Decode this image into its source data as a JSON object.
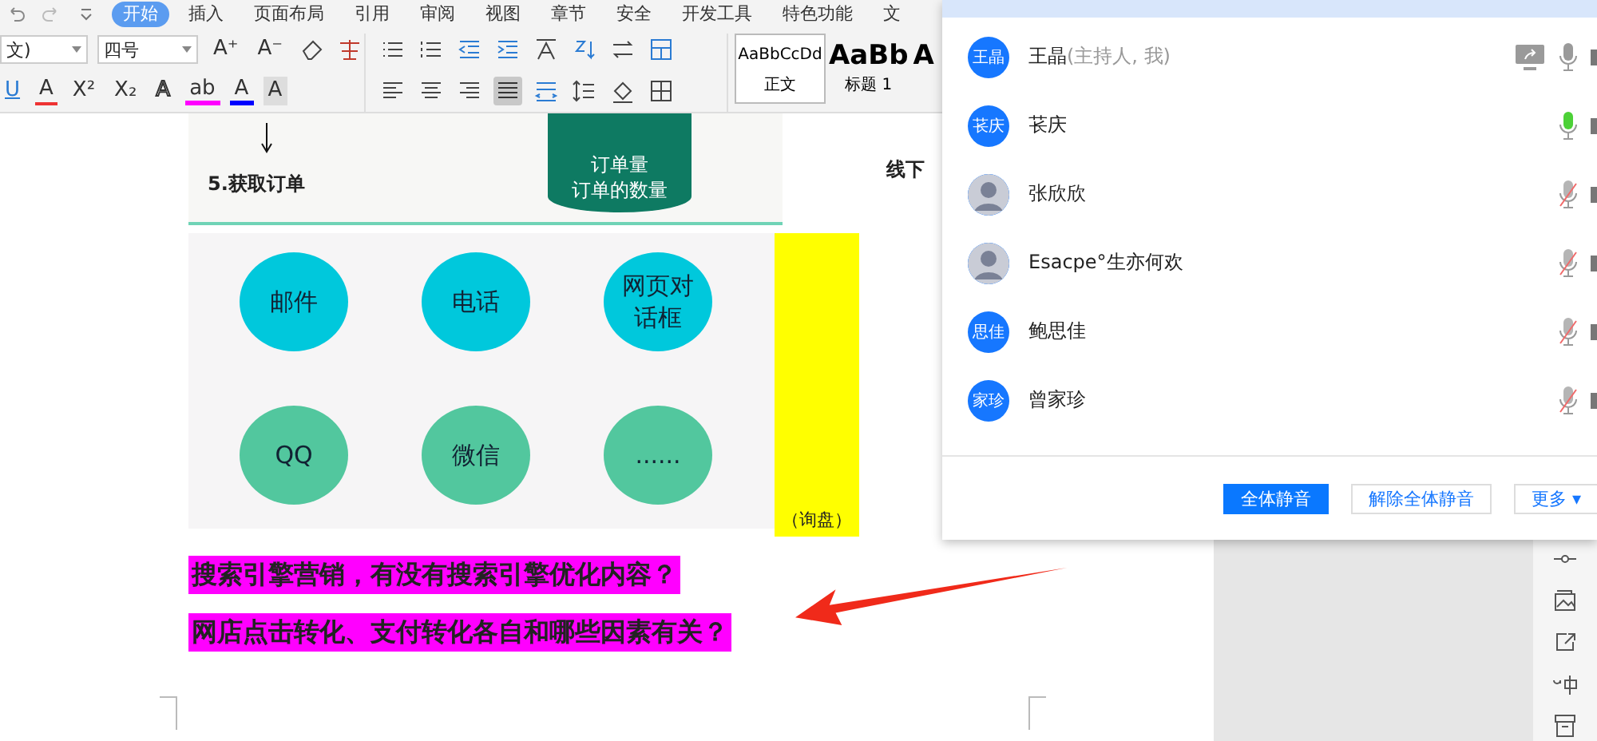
{
  "menu_tabs": [
    {
      "label": "开始",
      "selected": true
    },
    {
      "label": "插入",
      "selected": false
    },
    {
      "label": "页面布局",
      "selected": false
    },
    {
      "label": "引用",
      "selected": false
    },
    {
      "label": "审阅",
      "selected": false
    },
    {
      "label": "视图",
      "selected": false
    },
    {
      "label": "章节",
      "selected": false
    },
    {
      "label": "安全",
      "selected": false
    },
    {
      "label": "开发工具",
      "selected": false
    },
    {
      "label": "特色功能",
      "selected": false
    },
    {
      "label": "文",
      "selected": false
    }
  ],
  "toolbar": {
    "font_name": "文)",
    "font_size": "四号",
    "size_buttons": [
      "A⁺",
      "A⁻"
    ],
    "format_buttons": [
      {
        "glyph": "U",
        "kind": "underline",
        "selected": false
      },
      {
        "glyph": "A",
        "kind": "strike",
        "selected": false
      },
      {
        "glyph": "X²",
        "kind": "plain",
        "selected": false
      },
      {
        "glyph": "X₂",
        "kind": "plain",
        "selected": false
      },
      {
        "glyph": "A",
        "kind": "outline",
        "selected": false
      },
      {
        "glyph": "ab",
        "kind": "highlight",
        "selected": false
      },
      {
        "glyph": "A",
        "kind": "color",
        "selected": false
      },
      {
        "glyph": "A",
        "kind": "shade",
        "selected": false
      }
    ],
    "justify_selected": true,
    "styles": [
      {
        "sample": "AaBbCcDd",
        "label": "正文",
        "selected": true
      },
      {
        "sample": "AaBb",
        "label": "标题 1",
        "selected": false
      },
      {
        "sample": "A",
        "selected": false
      }
    ]
  },
  "slide": {
    "step_label": "5.获取订单",
    "cylinder_lines": [
      "订单量",
      "订单的数量"
    ],
    "side_label": "线下",
    "channels": [
      {
        "label": "邮件",
        "color": "#00c8dc"
      },
      {
        "label": "电话",
        "color": "#00c8dc"
      },
      {
        "label": "网页对话框",
        "color": "#00c8dc"
      },
      {
        "label": "QQ",
        "color": "#52c79e"
      },
      {
        "label": "微信",
        "color": "#52c79e"
      },
      {
        "label": "......",
        "color": "#52c79e"
      }
    ]
  },
  "highlight_note": "（询盘）",
  "paragraphs": [
    "搜索引擎营销，有没有搜索引擎优化内容？",
    "网店点击转化、支付转化各自和哪些因素有关？"
  ],
  "participants": {
    "members": [
      {
        "name": "王晶",
        "note": "(主持人, 我)",
        "avatar": "王晶",
        "kind": "initials",
        "muted": false,
        "speaking": false,
        "sharing": true
      },
      {
        "name": "苌庆",
        "avatar": "苌庆",
        "kind": "initials",
        "muted": false,
        "speaking": true,
        "sharing": false
      },
      {
        "name": "张欣欣",
        "kind": "photo",
        "muted": true,
        "speaking": false,
        "sharing": false
      },
      {
        "name": "Esacpe°生亦何欢",
        "kind": "photo",
        "muted": true,
        "speaking": false,
        "sharing": false
      },
      {
        "name": "鲍思佳",
        "avatar": "思佳",
        "kind": "initials",
        "muted": true,
        "speaking": false,
        "sharing": false
      },
      {
        "name": "曾家珍",
        "avatar": "家珍",
        "kind": "initials",
        "muted": true,
        "speaking": false,
        "sharing": false
      }
    ],
    "buttons": [
      {
        "label": "全体静音",
        "primary": true
      },
      {
        "label": "解除全体静音",
        "primary": false
      }
    ],
    "more": "更多",
    "more_caret": "▾"
  }
}
